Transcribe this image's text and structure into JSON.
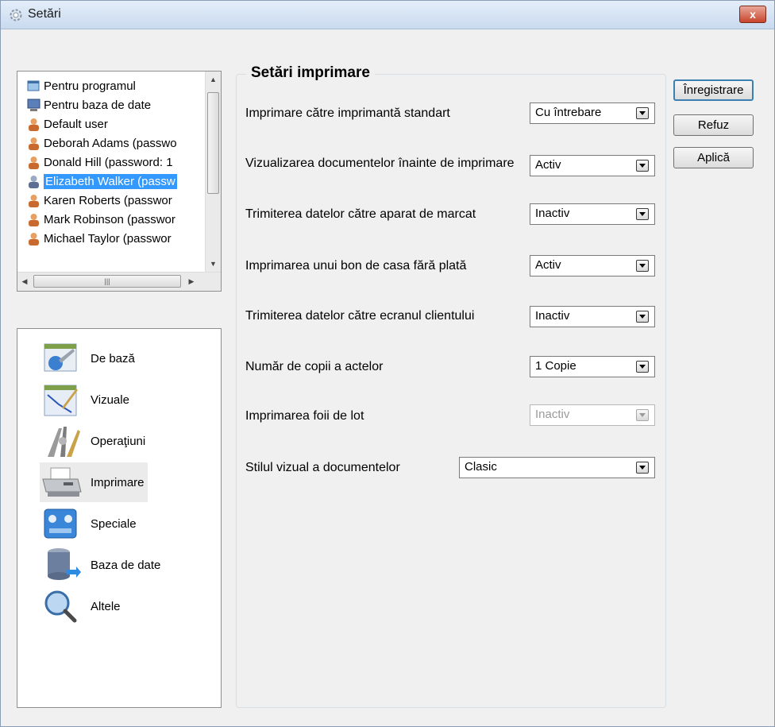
{
  "window": {
    "title": "Setări",
    "close_label": "x"
  },
  "users": [
    {
      "label": "Pentru programul",
      "icon": "program-icon"
    },
    {
      "label": "Pentru baza de date",
      "icon": "database-monitor-icon"
    },
    {
      "label": "Default user",
      "icon": "user-icon"
    },
    {
      "label": "Deborah Adams (passwo",
      "icon": "user-icon"
    },
    {
      "label": "Donald Hill (password: 1",
      "icon": "user-icon"
    },
    {
      "label": "Elizabeth Walker (passw",
      "icon": "user-icon",
      "selected": true
    },
    {
      "label": "Karen Roberts (passwor",
      "icon": "user-icon"
    },
    {
      "label": "Mark Robinson (passwor",
      "icon": "user-icon"
    },
    {
      "label": "Michael Taylor (passwor",
      "icon": "user-icon"
    }
  ],
  "categories": [
    {
      "label": "De bază",
      "icon": "basic-settings-icon"
    },
    {
      "label": "Vizuale",
      "icon": "visual-chart-icon"
    },
    {
      "label": "Operaţiuni",
      "icon": "operations-tools-icon"
    },
    {
      "label": "Imprimare",
      "icon": "printer-icon",
      "selected": true
    },
    {
      "label": "Speciale",
      "icon": "special-settings-icon"
    },
    {
      "label": "Baza de date",
      "icon": "database-icon"
    },
    {
      "label": "Altele",
      "icon": "magnifier-icon"
    }
  ],
  "group": {
    "title": "Setări imprimare"
  },
  "settings": [
    {
      "label": "Imprimare către imprimantă standart",
      "value": "Cu întrebare"
    },
    {
      "label": "Vizualizarea documentelor înainte de imprimare",
      "value": "Activ"
    },
    {
      "label": "Trimiterea datelor către aparat de marcat",
      "value": "Inactiv"
    },
    {
      "label": "Imprimarea unui bon de casa fără plată",
      "value": "Activ"
    },
    {
      "label": "Trimiterea datelor către ecranul clientului",
      "value": "Inactiv"
    },
    {
      "label": "Număr de copii a actelor",
      "value": "1 Copie"
    },
    {
      "label": "Imprimarea foii de lot",
      "value": "Inactiv",
      "disabled": true
    },
    {
      "label": "Stilul vizual a documentelor",
      "value": "Clasic"
    }
  ],
  "buttons": {
    "save": "Înregistrare",
    "cancel": "Refuz",
    "apply": "Aplică"
  },
  "colors": {
    "selection": "#3399ff",
    "title_bar": "#c9daef",
    "close_button": "#c8452c"
  }
}
